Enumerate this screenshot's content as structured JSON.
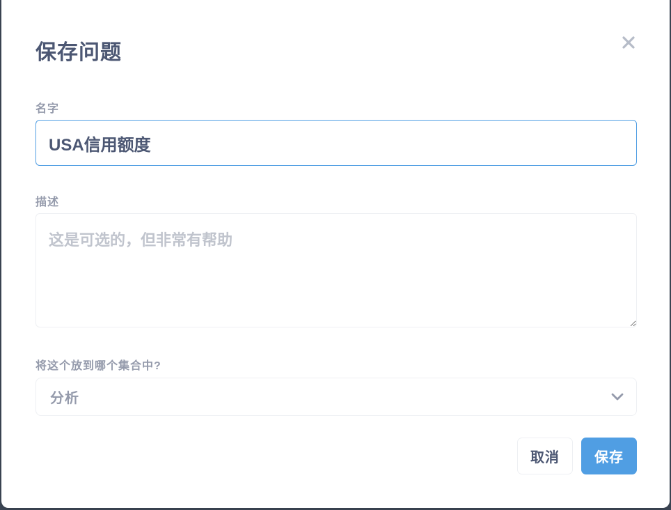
{
  "dialog": {
    "title": "保存问题",
    "close_icon": "close-icon"
  },
  "name_field": {
    "label": "名字",
    "value": "USA信用额度"
  },
  "description_field": {
    "label": "描述",
    "placeholder": "这是可选的，但非常有帮助",
    "value": ""
  },
  "collection_field": {
    "label": "将这个放到哪个集合中?",
    "selected": "分析",
    "chevron_icon": "chevron-down-icon"
  },
  "buttons": {
    "cancel_label": "取消",
    "save_label": "保存"
  },
  "colors": {
    "accent": "#509ee3",
    "title_text": "#4c5773",
    "label_text": "#949aab",
    "placeholder_text": "#c0c4cd",
    "border": "#eef0f3"
  }
}
